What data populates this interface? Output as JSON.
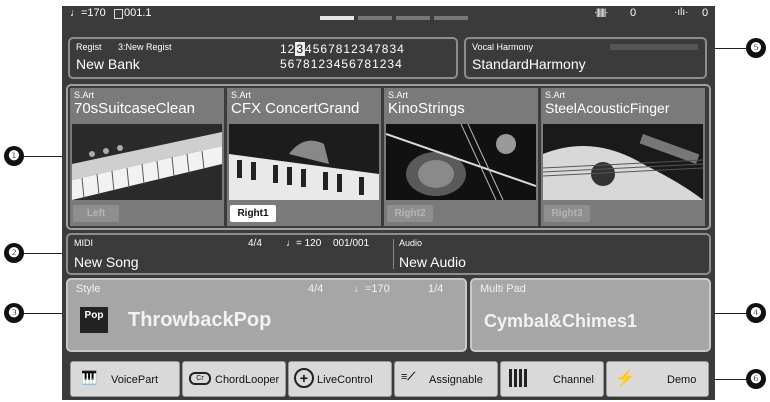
{
  "top": {
    "tempo": "♩=170",
    "position": "001.1",
    "left_counter": "0",
    "right_counter": "0"
  },
  "regist": {
    "title": "Regist",
    "current": "3:New Regist",
    "bank": "New Bank",
    "row1_a": "12",
    "row1_sel": "3",
    "row1_b": "4567812347834",
    "row2": "5678123456781234"
  },
  "vocal": {
    "title": "Vocal Harmony",
    "name": "StandardHarmony"
  },
  "voices": [
    {
      "tag": "S.Art",
      "name": "70sSuitcaseClean",
      "part": "Left",
      "active": false
    },
    {
      "tag": "S.Art",
      "name": "CFX ConcertGrand",
      "part": "Right1",
      "active": true
    },
    {
      "tag": "S.Art",
      "name": "KinoStrings",
      "part": "Right2",
      "active": false
    },
    {
      "tag": "S.Art",
      "name": "SteelAcousticFinger",
      "part": "Right3",
      "active": false
    }
  ],
  "song": {
    "midi_label": "MIDI",
    "time_sig": "4/4",
    "tempo": "♩= 120",
    "measure": "001/001",
    "song_name": "New Song",
    "audio_label": "Audio",
    "audio_name": "New Audio"
  },
  "style": {
    "label": "Style",
    "time_sig": "4/4",
    "tempo": "♩=170",
    "beat": "1/4",
    "icon_text": "Pop",
    "name": "ThrowbackPop"
  },
  "multipad": {
    "label": "Multi Pad",
    "name": "Cymbal&Chimes1"
  },
  "buttons": [
    "VoicePart",
    "ChordLooper",
    "LiveControl",
    "Assignable",
    "Channel",
    "Demo"
  ],
  "callouts": [
    "❶",
    "❷",
    "❸",
    "❹",
    "❺",
    "❻"
  ]
}
